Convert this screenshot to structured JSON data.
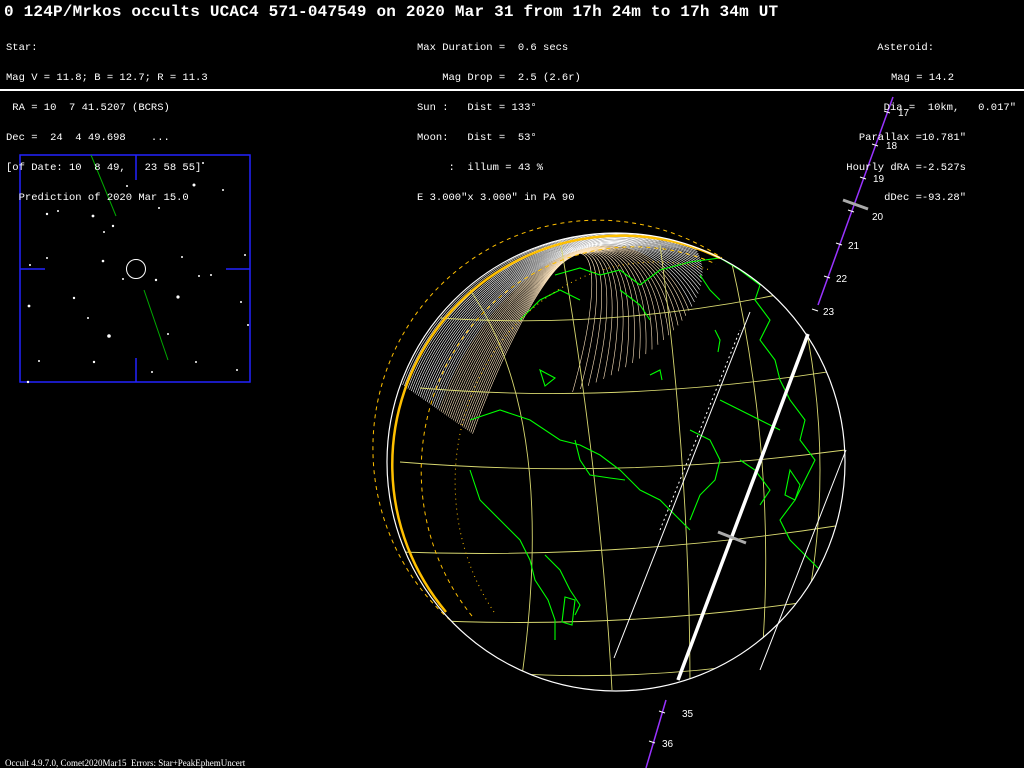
{
  "header": {
    "title": "0 124P/Mrkos occults UCAC4 571-047549 on 2020 Mar 31 from 17h 24m to 17h 34m UT",
    "star_lines": [
      "Star:",
      "Mag V = 11.8; B = 12.7; R = 11.3",
      " RA = 10  7 41.5207 (BCRS)",
      "Dec =  24  4 49.698    ...",
      "[of Date: 10  8 49,   23 58 55]",
      "  Prediction of 2020 Mar 15.0"
    ],
    "event_lines": [
      "Max Duration =  0.6 secs",
      "    Mag Drop =  2.5 (2.6r)",
      "Sun :   Dist = 133°",
      "Moon:   Dist =  53°",
      "     :  illum = 43 %",
      "E 3.000\"x 3.000\" in PA 90"
    ],
    "asteroid_lines": [
      "Asteroid:",
      "Mag = 14.2",
      "Dia =  10km,   0.017\"",
      "Parallax =10.781\"",
      "Hourly dRA =-2.527s",
      "dDec =-93.28\""
    ]
  },
  "time_ticks_top": [
    "17",
    "18",
    "19",
    "20",
    "21",
    "22",
    "23"
  ],
  "time_ticks_bottom": [
    "35",
    "36"
  ],
  "footer": "Occult 4.9.7.0, Comet2020Mar15  Errors: Star+PeakEphemUncert",
  "colors": {
    "background": "#000000",
    "land": "#00ff00",
    "grid": "#d8d870",
    "terminator": "#ffc000",
    "path": "#ffffff",
    "track": "#9933ff",
    "finder_frame": "#2222ff"
  }
}
